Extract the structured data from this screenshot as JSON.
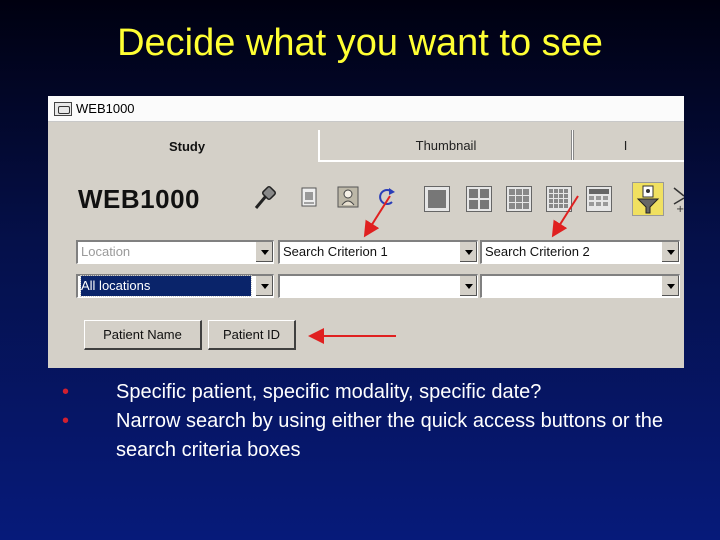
{
  "slide": {
    "title": "Decide what you want to see"
  },
  "window": {
    "title": "WEB1000"
  },
  "tabs": [
    {
      "label": "Study"
    },
    {
      "label": "Thumbnail"
    },
    {
      "label": "I"
    }
  ],
  "brand": {
    "text": "WEB1000"
  },
  "toolbar": {
    "icons": [
      "pin-icon",
      "document-icon",
      "patient-portrait-icon",
      "refresh-icon",
      "single-view-icon",
      "grid-2x2-icon",
      "grid-3x3-icon",
      "grid-4x4-icon",
      "calendar-grid-icon",
      "filter-icon"
    ]
  },
  "search": {
    "location_placeholder": "Location",
    "criterion1": "Search Criterion 1",
    "criterion2": "Search Criterion 2",
    "location_value": "All locations",
    "criterion1_value": "",
    "criterion2_value": ""
  },
  "buttons": {
    "patient_name": "Patient Name",
    "patient_id": "Patient ID"
  },
  "bullets": [
    "Specific patient, specific modality, specific date?",
    "Narrow search by using either the quick access buttons or the search criteria boxes"
  ],
  "colors": {
    "title": "#ffff33",
    "bullet_dot": "#d02030",
    "arrow": "#e02020",
    "selection": "#0a246a"
  }
}
